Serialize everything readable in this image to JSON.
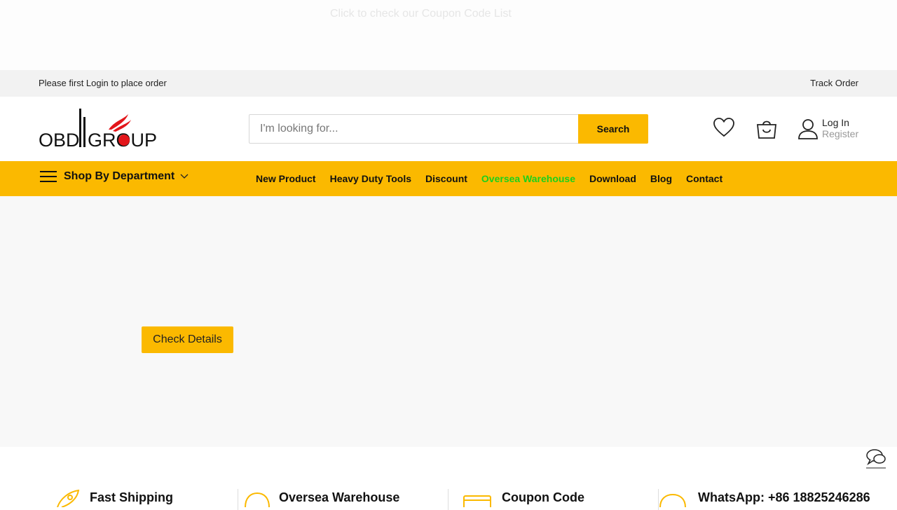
{
  "coupon_bar": {
    "link": "Click to check our Coupon Code List"
  },
  "top_strip": {
    "login_note": "Please first Login to place order",
    "track_order": "Track Order"
  },
  "logo": {
    "text_left": "OBD",
    "text_right": "GROUP"
  },
  "search": {
    "placeholder": "I'm looking for...",
    "button": "Search"
  },
  "account": {
    "login": "Log In",
    "register": "Register"
  },
  "nav": {
    "department": "Shop By Department",
    "items": [
      {
        "label": "New Product"
      },
      {
        "label": "Heavy Duty Tools"
      },
      {
        "label": "Discount"
      },
      {
        "label": "Oversea Warehouse"
      },
      {
        "label": "Download"
      },
      {
        "label": "Blog"
      },
      {
        "label": "Contact"
      }
    ]
  },
  "hero": {
    "cta": "Check Details"
  },
  "features": [
    {
      "title": "Fast Shipping",
      "icon": "rocket-icon"
    },
    {
      "title": "Oversea Warehouse",
      "icon": "warehouse-icon"
    },
    {
      "title": "Coupon Code",
      "icon": "card-icon"
    },
    {
      "title": "WhatsApp: +86 18825246286",
      "icon": "whatsapp-icon"
    }
  ],
  "colors": {
    "accent": "#fbb900",
    "nav_highlight": "#1bd11b",
    "logo_red": "#e3161b"
  }
}
